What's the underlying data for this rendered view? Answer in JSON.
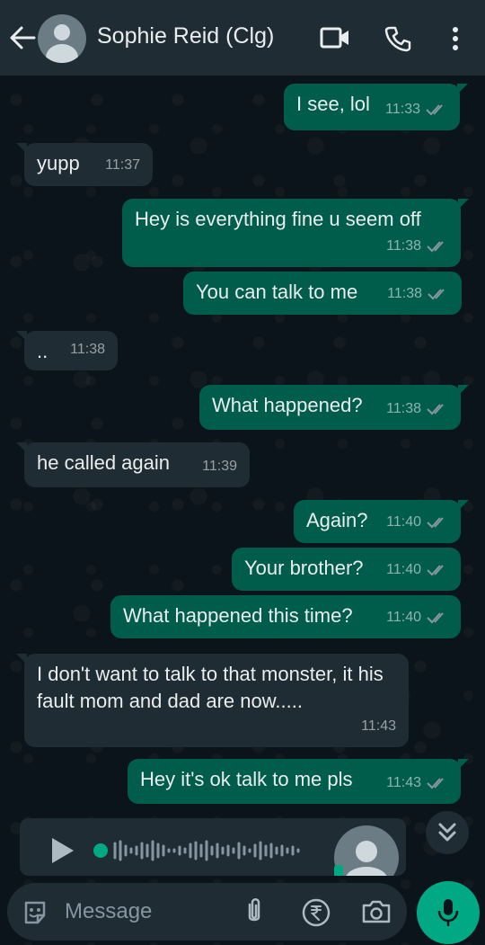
{
  "header": {
    "contact_name": "Sophie Reid (Clg)"
  },
  "messages": [
    {
      "dir": "out",
      "text": "I see, lol",
      "time": "11:33"
    },
    {
      "dir": "in",
      "text": "yupp",
      "time": "11:37"
    },
    {
      "dir": "out",
      "text": "Hey is everything fine u seem off",
      "time": "11:38"
    },
    {
      "dir": "out",
      "text": "You can talk to me",
      "time": "11:38"
    },
    {
      "dir": "in",
      "text": "..",
      "time": "11:38"
    },
    {
      "dir": "out",
      "text": "What happened?",
      "time": "11:38"
    },
    {
      "dir": "in",
      "text": "he called again",
      "time": "11:39"
    },
    {
      "dir": "out",
      "text": "Again?",
      "time": "11:40"
    },
    {
      "dir": "out",
      "text": "Your brother?",
      "time": "11:40"
    },
    {
      "dir": "out",
      "text": "What happened this time?",
      "time": "11:40"
    },
    {
      "dir": "in",
      "text": "I don't want to talk to that monster, it his fault mom and dad are now.....",
      "time": "11:43"
    },
    {
      "dir": "out",
      "text": "Hey it's ok talk to me pls",
      "time": "11:43"
    }
  ],
  "composer": {
    "placeholder": "Message"
  },
  "colors": {
    "outgoing_bubble": "#005c4b",
    "incoming_bubble": "#1f2c34",
    "accent": "#00a884",
    "read_ticks": "#8696a0"
  },
  "icons": [
    "back-arrow-icon",
    "video-call-icon",
    "phone-icon",
    "more-vert-icon",
    "sticker-icon",
    "attach-icon",
    "rupee-icon",
    "camera-icon",
    "mic-icon",
    "play-icon",
    "double-chevron-down-icon"
  ]
}
